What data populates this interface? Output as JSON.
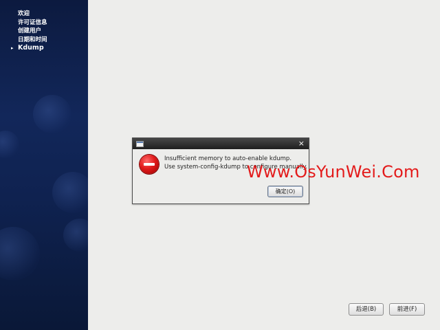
{
  "sidebar": {
    "items": [
      {
        "label": "欢迎",
        "active": false
      },
      {
        "label": "许可证信息",
        "active": false
      },
      {
        "label": "创建用户",
        "active": false
      },
      {
        "label": "日期和时间",
        "active": false
      },
      {
        "label": "Kdump",
        "active": true
      }
    ],
    "active_marker": "▸"
  },
  "dialog": {
    "close_glyph": "×",
    "icon": "error-icon",
    "message_line1": "Insufficient memory to auto-enable kdump.",
    "message_line2": "Use system-config-kdump to configure manually.",
    "ok_label": "确定(O)"
  },
  "footer": {
    "back_label": "后退(B)",
    "next_label": "前进(F)"
  },
  "watermark": "Www.OsYunWei.Com"
}
